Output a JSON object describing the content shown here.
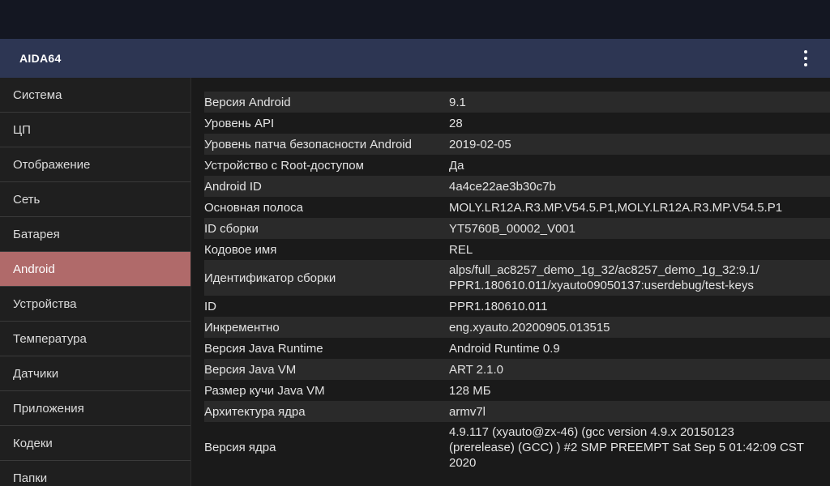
{
  "app": {
    "title": "AIDA64",
    "menu_icon": "more-vert-icon"
  },
  "sidebar": {
    "items": [
      {
        "label": "Система"
      },
      {
        "label": "ЦП"
      },
      {
        "label": "Отображение"
      },
      {
        "label": "Сеть"
      },
      {
        "label": "Батарея"
      },
      {
        "label": "Android"
      },
      {
        "label": "Устройства"
      },
      {
        "label": "Температура"
      },
      {
        "label": "Датчики"
      },
      {
        "label": "Приложения"
      },
      {
        "label": "Кодеки"
      },
      {
        "label": "Папки"
      }
    ],
    "active_index": 5,
    "active_color": "#b06a6a"
  },
  "details": {
    "rows": [
      {
        "label": "Версия Android",
        "value": "9.1"
      },
      {
        "label": "Уровень API",
        "value": "28"
      },
      {
        "label": "Уровень патча безопасности Android",
        "value": "2019-02-05"
      },
      {
        "label": "Устройство с Root-доступом",
        "value": "Да"
      },
      {
        "label": "Android ID",
        "value": "4a4ce22ae3b30c7b"
      },
      {
        "label": "Основная полоса",
        "value": "MOLY.LR12A.R3.MP.V54.5.P1,MOLY.LR12A.R3.MP.V54.5.P1"
      },
      {
        "label": "ID сборки",
        "value": "YT5760B_00002_V001"
      },
      {
        "label": "Кодовое имя",
        "value": "REL"
      },
      {
        "label": "Идентификатор сборки",
        "value": "alps/full_ac8257_demo_1g_32/ac8257_demo_1g_32:9.1/\nPPR1.180610.011/xyauto09050137:userdebug/test-keys"
      },
      {
        "label": "ID",
        "value": "PPR1.180610.011"
      },
      {
        "label": "Инкрементно",
        "value": "eng.xyauto.20200905.013515"
      },
      {
        "label": "Версия Java Runtime",
        "value": "Android Runtime 0.9"
      },
      {
        "label": "Версия Java VM",
        "value": "ART 2.1.0"
      },
      {
        "label": "Размер кучи Java VM",
        "value": "128 МБ"
      },
      {
        "label": "Архитектура ядра",
        "value": "armv7l"
      },
      {
        "label": "Версия ядра",
        "value": "4.9.117 (xyauto@zx-46) (gcc version 4.9.x 20150123\n(prerelease) (GCC) ) #2 SMP PREEMPT Sat Sep 5 01:42:09 CST\n2020"
      }
    ]
  }
}
